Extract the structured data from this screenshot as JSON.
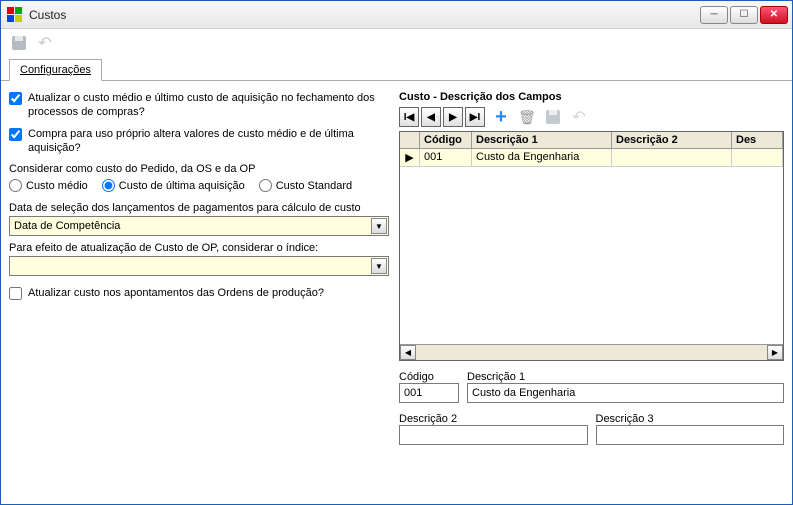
{
  "window": {
    "title": "Custos"
  },
  "tab": {
    "label": "Configurações"
  },
  "checks": {
    "chk1": "Atualizar o custo médio e último custo de aquisição no fechamento dos processos de compras?",
    "chk2": "Compra para uso próprio altera valores de custo médio e de última aquisição?",
    "chk3": "Atualizar custo nos apontamentos das Ordens de produção?"
  },
  "cost_group": {
    "label": "Considerar como custo do Pedido, da OS e da OP",
    "opt1": "Custo médio",
    "opt2": "Custo de última aquisição",
    "opt3": "Custo Standard"
  },
  "combo1": {
    "label": "Data de seleção dos lançamentos de pagamentos para cálculo de custo",
    "value": "Data de Competência"
  },
  "combo2": {
    "label": "Para efeito de atualização de Custo de OP, considerar o índice:",
    "value": ""
  },
  "right": {
    "title": "Custo - Descrição dos Campos",
    "headers": {
      "codigo": "Código",
      "d1": "Descrição 1",
      "d2": "Descrição 2",
      "d3": "Des"
    },
    "row": {
      "codigo": "001",
      "d1": "Custo da Engenharia",
      "d2": "",
      "d3": ""
    }
  },
  "edit": {
    "codigo_label": "Código",
    "d1_label": "Descrição 1",
    "d2_label": "Descrição 2",
    "d3_label": "Descrição 3",
    "codigo": "001",
    "d1": "Custo da Engenharia",
    "d2": "",
    "d3": ""
  }
}
